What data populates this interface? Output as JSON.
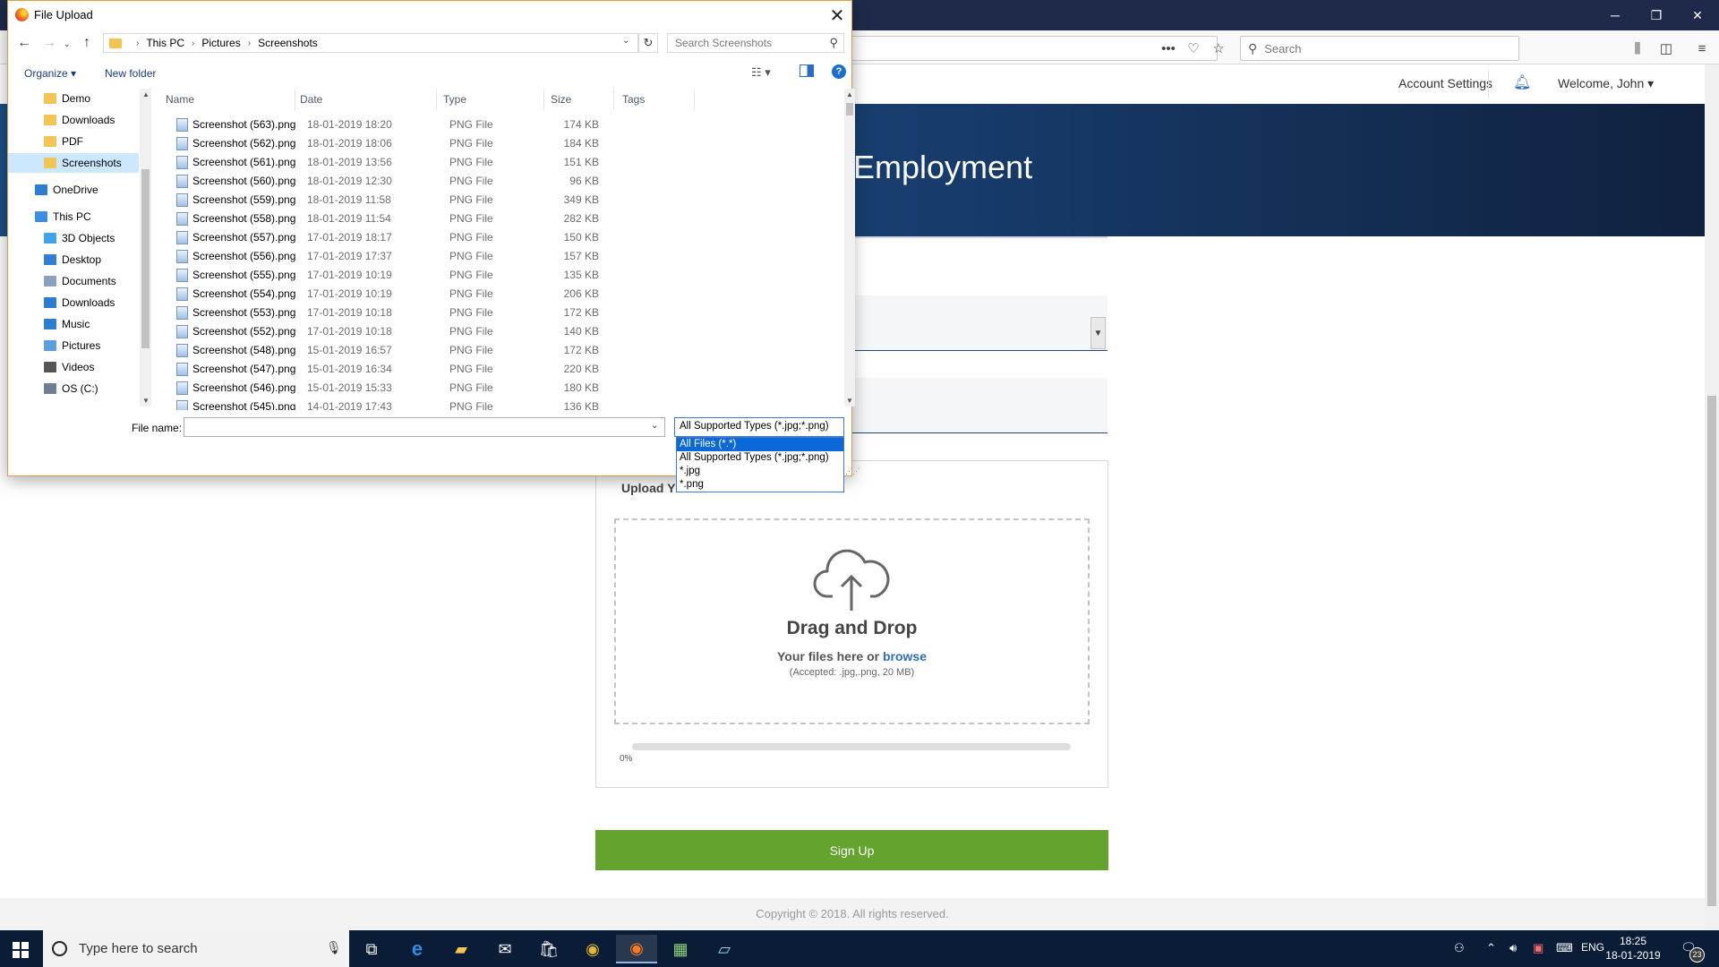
{
  "browser": {
    "search_placeholder": "Search",
    "window_controls": {
      "minimize": "─",
      "restore": "❐",
      "close": "✕"
    }
  },
  "page": {
    "account_settings": "Account Settings",
    "welcome": "Welcome, John ▾",
    "hero_title": "Employment",
    "upload_heading": "Upload Y",
    "drag_title": "Drag and Drop",
    "drag_sub_prefix": "Your files here or ",
    "drag_sub_link": "browse",
    "accepted": "(Accepted: .jpg,.png, 20 MB)",
    "progress_label": "0%",
    "progress_percent": 0,
    "signup": "Sign Up",
    "footer": "Copyright © 2018. All rights reserved."
  },
  "dialog": {
    "title": "File Upload",
    "close": "✕",
    "breadcrumb": [
      "This PC",
      "Pictures",
      "Screenshots"
    ],
    "search_placeholder": "Search Screenshots",
    "organize": "Organize ▾",
    "new_folder": "New folder",
    "help": "?",
    "nav_items": [
      {
        "label": "Demo",
        "icon": "folder-icon",
        "color": "#f3c454"
      },
      {
        "label": "Downloads",
        "icon": "folder-icon",
        "color": "#f3c454"
      },
      {
        "label": "PDF",
        "icon": "folder-icon",
        "color": "#f3c454"
      },
      {
        "label": "Screenshots",
        "icon": "folder-icon",
        "color": "#f3c454",
        "selected": true
      },
      {
        "label": "OneDrive",
        "icon": "cloud-icon",
        "color": "#2b7cd3"
      },
      {
        "label": "This PC",
        "icon": "computer-icon",
        "color": "#3a8ee6"
      },
      {
        "label": "3D Objects",
        "icon": "cube-icon",
        "color": "#41a5ee"
      },
      {
        "label": "Desktop",
        "icon": "desktop-icon",
        "color": "#2f7fd6"
      },
      {
        "label": "Documents",
        "icon": "documents-icon",
        "color": "#8aa1bd"
      },
      {
        "label": "Downloads",
        "icon": "download-icon",
        "color": "#2b7cd3"
      },
      {
        "label": "Music",
        "icon": "music-icon",
        "color": "#2b7cd3"
      },
      {
        "label": "Pictures",
        "icon": "pictures-icon",
        "color": "#5aa0e0"
      },
      {
        "label": "Videos",
        "icon": "videos-icon",
        "color": "#555"
      },
      {
        "label": "OS (C:)",
        "icon": "drive-icon",
        "color": "#6f7e93"
      }
    ],
    "columns": [
      "Name",
      "Date",
      "Type",
      "Size",
      "Tags"
    ],
    "files": [
      {
        "name": "Screenshot (563).png",
        "date": "18-01-2019 18:20",
        "type": "PNG File",
        "size": "174 KB"
      },
      {
        "name": "Screenshot (562).png",
        "date": "18-01-2019 18:06",
        "type": "PNG File",
        "size": "184 KB"
      },
      {
        "name": "Screenshot (561).png",
        "date": "18-01-2019 13:56",
        "type": "PNG File",
        "size": "151 KB"
      },
      {
        "name": "Screenshot (560).png",
        "date": "18-01-2019 12:30",
        "type": "PNG File",
        "size": "96 KB"
      },
      {
        "name": "Screenshot (559).png",
        "date": "18-01-2019 11:58",
        "type": "PNG File",
        "size": "349 KB"
      },
      {
        "name": "Screenshot (558).png",
        "date": "18-01-2019 11:54",
        "type": "PNG File",
        "size": "282 KB"
      },
      {
        "name": "Screenshot (557).png",
        "date": "17-01-2019 18:17",
        "type": "PNG File",
        "size": "150 KB"
      },
      {
        "name": "Screenshot (556).png",
        "date": "17-01-2019 17:37",
        "type": "PNG File",
        "size": "157 KB"
      },
      {
        "name": "Screenshot (555).png",
        "date": "17-01-2019 10:19",
        "type": "PNG File",
        "size": "135 KB"
      },
      {
        "name": "Screenshot (554).png",
        "date": "17-01-2019 10:19",
        "type": "PNG File",
        "size": "206 KB"
      },
      {
        "name": "Screenshot (553).png",
        "date": "17-01-2019 10:18",
        "type": "PNG File",
        "size": "172 KB"
      },
      {
        "name": "Screenshot (552).png",
        "date": "17-01-2019 10:18",
        "type": "PNG File",
        "size": "140 KB"
      },
      {
        "name": "Screenshot (548).png",
        "date": "15-01-2019 16:57",
        "type": "PNG File",
        "size": "172 KB"
      },
      {
        "name": "Screenshot (547).png",
        "date": "15-01-2019 16:34",
        "type": "PNG File",
        "size": "220 KB"
      },
      {
        "name": "Screenshot (546).png",
        "date": "15-01-2019 15:33",
        "type": "PNG File",
        "size": "180 KB"
      },
      {
        "name": "Screenshot (545).png",
        "date": "14-01-2019 17:43",
        "type": "PNG File",
        "size": "136 KB"
      }
    ],
    "file_name_label": "File name:",
    "file_name_value": "",
    "type_selected": "All Supported Types (*.jpg;*.png)",
    "type_options": [
      "All Files (*.*)",
      "All Supported Types (*.jpg;*.png)",
      "*.jpg",
      "*.png"
    ],
    "type_active_index": 0
  },
  "taskbar": {
    "search_placeholder": "Type here to search",
    "language": "ENG",
    "time": "18:25",
    "date": "18-01-2019",
    "notifications": "23"
  }
}
